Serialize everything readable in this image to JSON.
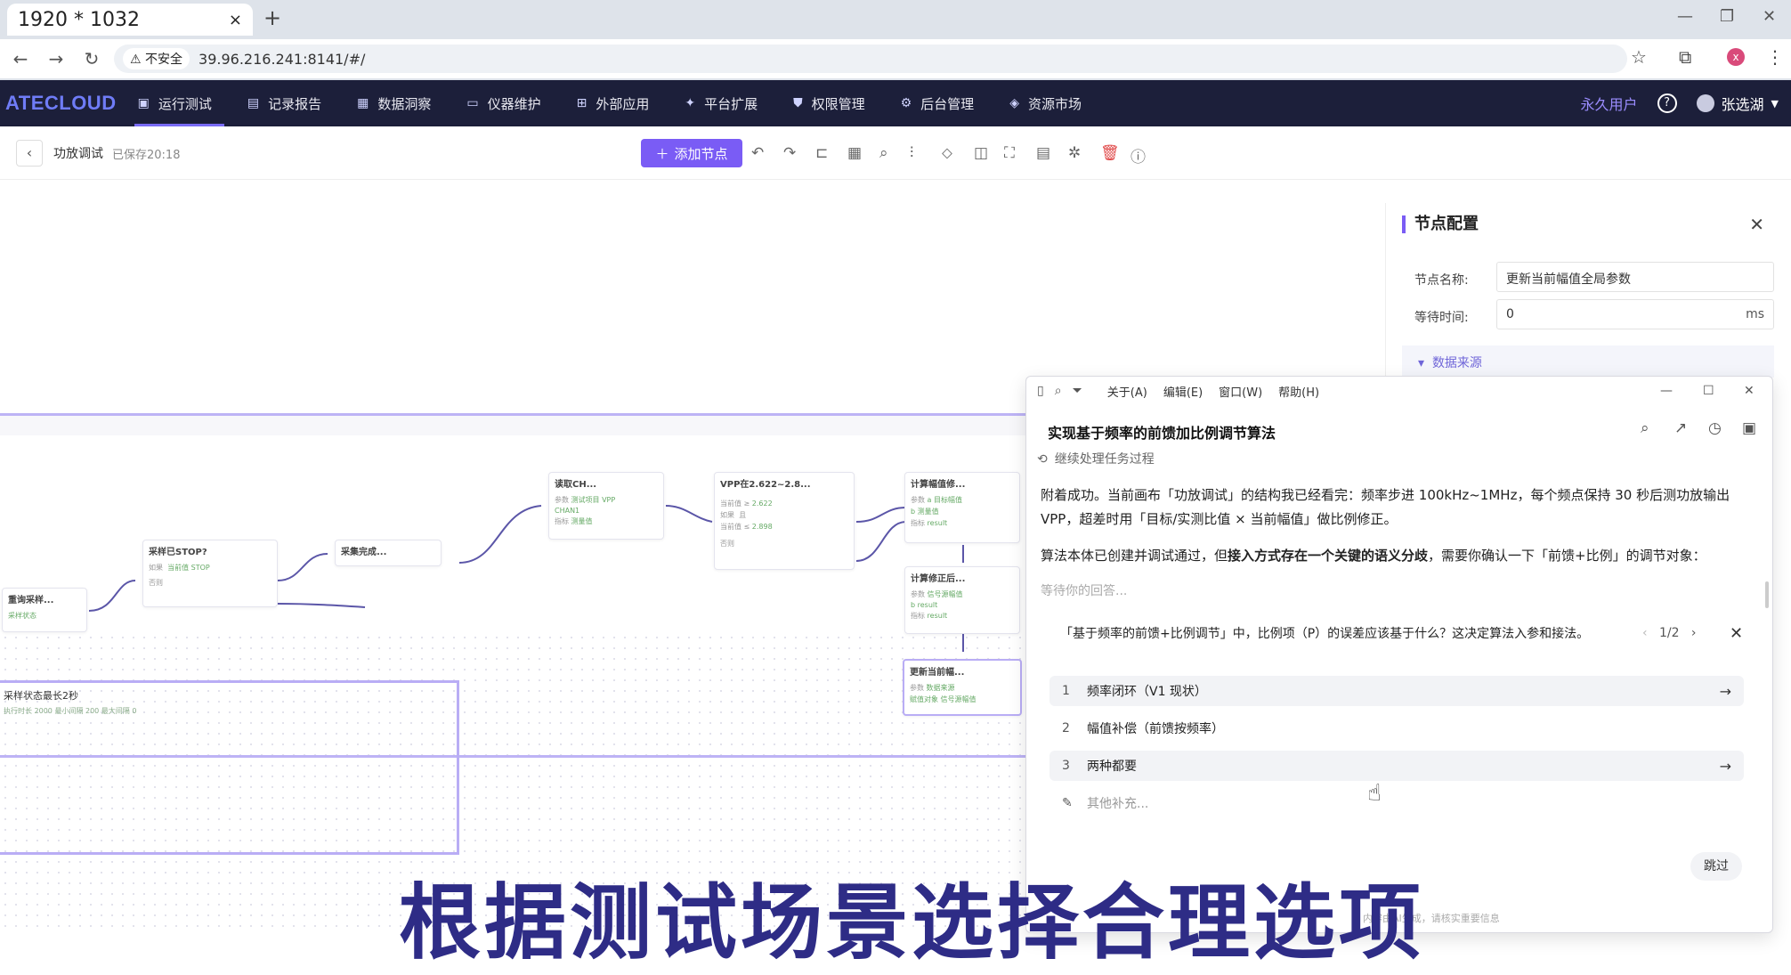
{
  "browser": {
    "tab_title": "1920 * 1032",
    "tab_close": "×",
    "new_tab": "+",
    "security_label": "⚠ 不安全",
    "url": "39.96.216.241:8141/#/"
  },
  "app": {
    "logo": "ATECLOUD",
    "nav": [
      {
        "label": "运行测试",
        "icon": "run-test-icon"
      },
      {
        "label": "记录报告",
        "icon": "report-icon"
      },
      {
        "label": "数据洞察",
        "icon": "insight-icon"
      },
      {
        "label": "仪器维护",
        "icon": "instrument-icon"
      },
      {
        "label": "外部应用",
        "icon": "apps-icon"
      },
      {
        "label": "平台扩展",
        "icon": "extension-icon"
      },
      {
        "label": "权限管理",
        "icon": "permission-icon"
      },
      {
        "label": "后台管理",
        "icon": "admin-icon"
      },
      {
        "label": "资源市场",
        "icon": "market-icon"
      }
    ],
    "user_type": "永久用户",
    "username": "张选湖"
  },
  "toolbar": {
    "flow_title": "功放调试",
    "saved_text": "已保存20:18",
    "add_node_label": "添加节点"
  },
  "canvas": {
    "group_title": "采样状态最长2秒",
    "group_params": "执行时长 2000   最小间隔 200   最大间隔 0",
    "nodes": {
      "stop_check": "采样已STOP?",
      "sample_done": "采集完成...",
      "requery": "重询采样...",
      "read_ch": "读取CH...",
      "vpp_check": "VPP在2.622~2.8...",
      "calc_amp": "计算幅值修...",
      "calc_after": "计算修正后...",
      "update_current": "更新当前幅..."
    },
    "labels": {
      "if": "如果",
      "else": "否则",
      "params": "参数",
      "metrics": "指标",
      "current_value": "当前值",
      "stop": "STOP",
      "v_low": "2.622",
      "v_high": "2.898",
      "and": "且",
      "result": "result",
      "sample_status": "采样状态",
      "data_source": "数据来源",
      "amp_param": "幅值参数",
      "test_vpp": "测试项目 VPP",
      "channel": "CHAN1",
      "measure": "测量值",
      "signal_amp": "信号源幅值",
      "target": "a 目标幅值",
      "measured": "b 测量值",
      "b_result": "b result",
      "write_target": "赋值对象 信号源幅值"
    }
  },
  "node_config": {
    "title": "节点配置",
    "name_label": "节点名称:",
    "name_value": "更新当前幅值全局参数",
    "wait_label": "等待时间:",
    "wait_value": "0",
    "wait_unit": "ms",
    "data_source": "数据来源"
  },
  "chat": {
    "menus": [
      "关于(A)",
      "编辑(E)",
      "窗口(W)",
      "帮助(H)"
    ],
    "title": "实现基于频率的前馈加比例调节算法",
    "process": "继续处理任务过程",
    "p1": "附着成功。当前画布「功放调试」的结构我已经看完：频率步进 100kHz~1MHz，每个频点保持 30 秒后测功放输出 VPP，超差时用「目标/实测比值 × 当前幅值」做比例修正。",
    "p2_a": "算法本体已创建并调试通过，但",
    "p2_bold": "接入方式存在一个关键的语义分歧",
    "p2_b": "，需要你确认一下「前馈+比例」的调节对象：",
    "waiting": "等待你的回答...",
    "question": "「基于频率的前馈+比例调节」中，比例项（P）的误差应该基于什么？这决定算法入参和接法。",
    "page": "1/2",
    "options": [
      {
        "num": "1",
        "label": "频率闭环（V1 现状）"
      },
      {
        "num": "2",
        "label": "幅值补偿（前馈按频率）"
      },
      {
        "num": "3",
        "label": "两种都要"
      }
    ],
    "other": "其他补充...",
    "skip": "跳过",
    "footer": "内容由AI生成，请核实重要信息"
  },
  "caption": "根据测试场景选择合理选项",
  "colors": {
    "accent": "#7a5cf5",
    "nav_bg": "#1c1f3a",
    "caption": "#2e2c86"
  }
}
